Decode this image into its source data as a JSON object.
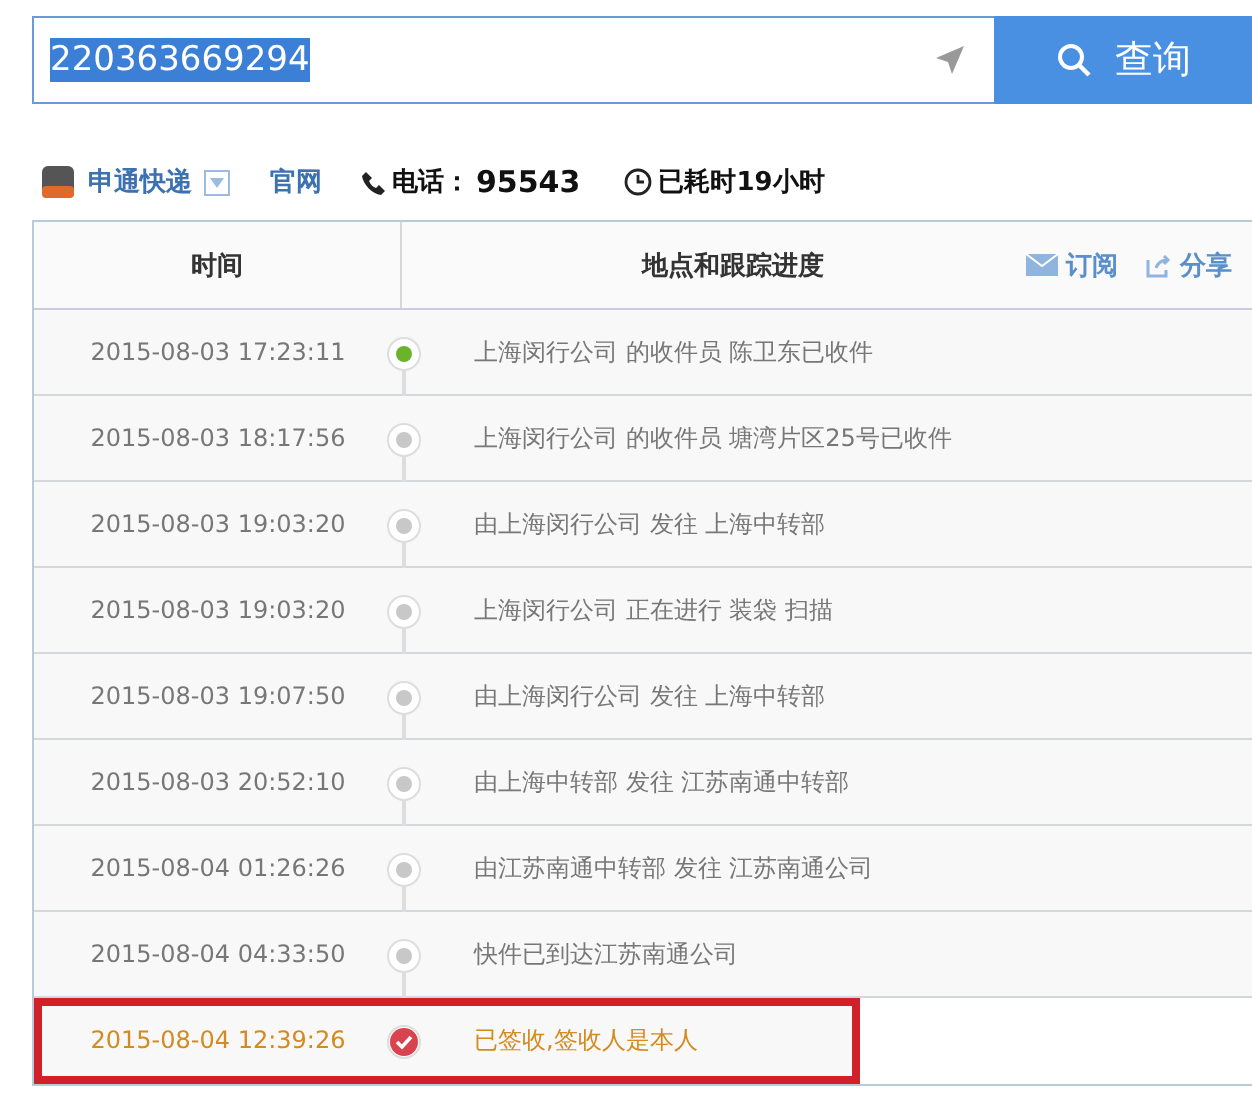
{
  "search": {
    "value": "220363669294",
    "button": "查询"
  },
  "carrier": {
    "name": "申通快递",
    "site_link": "官网",
    "phone_label": "电话：",
    "phone": "95543",
    "elapsed": "已耗时19小时"
  },
  "table": {
    "columns": [
      "时间",
      "地点和跟踪进度"
    ],
    "actions": [
      "订阅",
      "分享"
    ],
    "rows": [
      {
        "time": "2015-08-03 17:23:11",
        "event": "上海闵行公司 的收件员 陈卫东已收件",
        "kind": "first",
        "highlighted": false
      },
      {
        "time": "2015-08-03 18:17:56",
        "event": "上海闵行公司 的收件员 塘湾片区25号已收件",
        "kind": "normal",
        "highlighted": false
      },
      {
        "time": "2015-08-03 19:03:20",
        "event": "由上海闵行公司 发往 上海中转部",
        "kind": "normal",
        "highlighted": false
      },
      {
        "time": "2015-08-03 19:03:20",
        "event": "上海闵行公司 正在进行 装袋 扫描",
        "kind": "normal",
        "highlighted": false
      },
      {
        "time": "2015-08-03 19:07:50",
        "event": "由上海闵行公司 发往 上海中转部",
        "kind": "normal",
        "highlighted": false
      },
      {
        "time": "2015-08-03 20:52:10",
        "event": "由上海中转部 发往 江苏南通中转部",
        "kind": "normal",
        "highlighted": false
      },
      {
        "time": "2015-08-04 01:26:26",
        "event": "由江苏南通中转部 发往 江苏南通公司",
        "kind": "normal",
        "highlighted": false
      },
      {
        "time": "2015-08-04 04:33:50",
        "event": "快件已到达江苏南通公司",
        "kind": "normal",
        "highlighted": false
      },
      {
        "time": "2015-08-04 12:39:26",
        "event": "已签收,签收人是本人",
        "kind": "delivered",
        "highlighted": true
      }
    ]
  }
}
